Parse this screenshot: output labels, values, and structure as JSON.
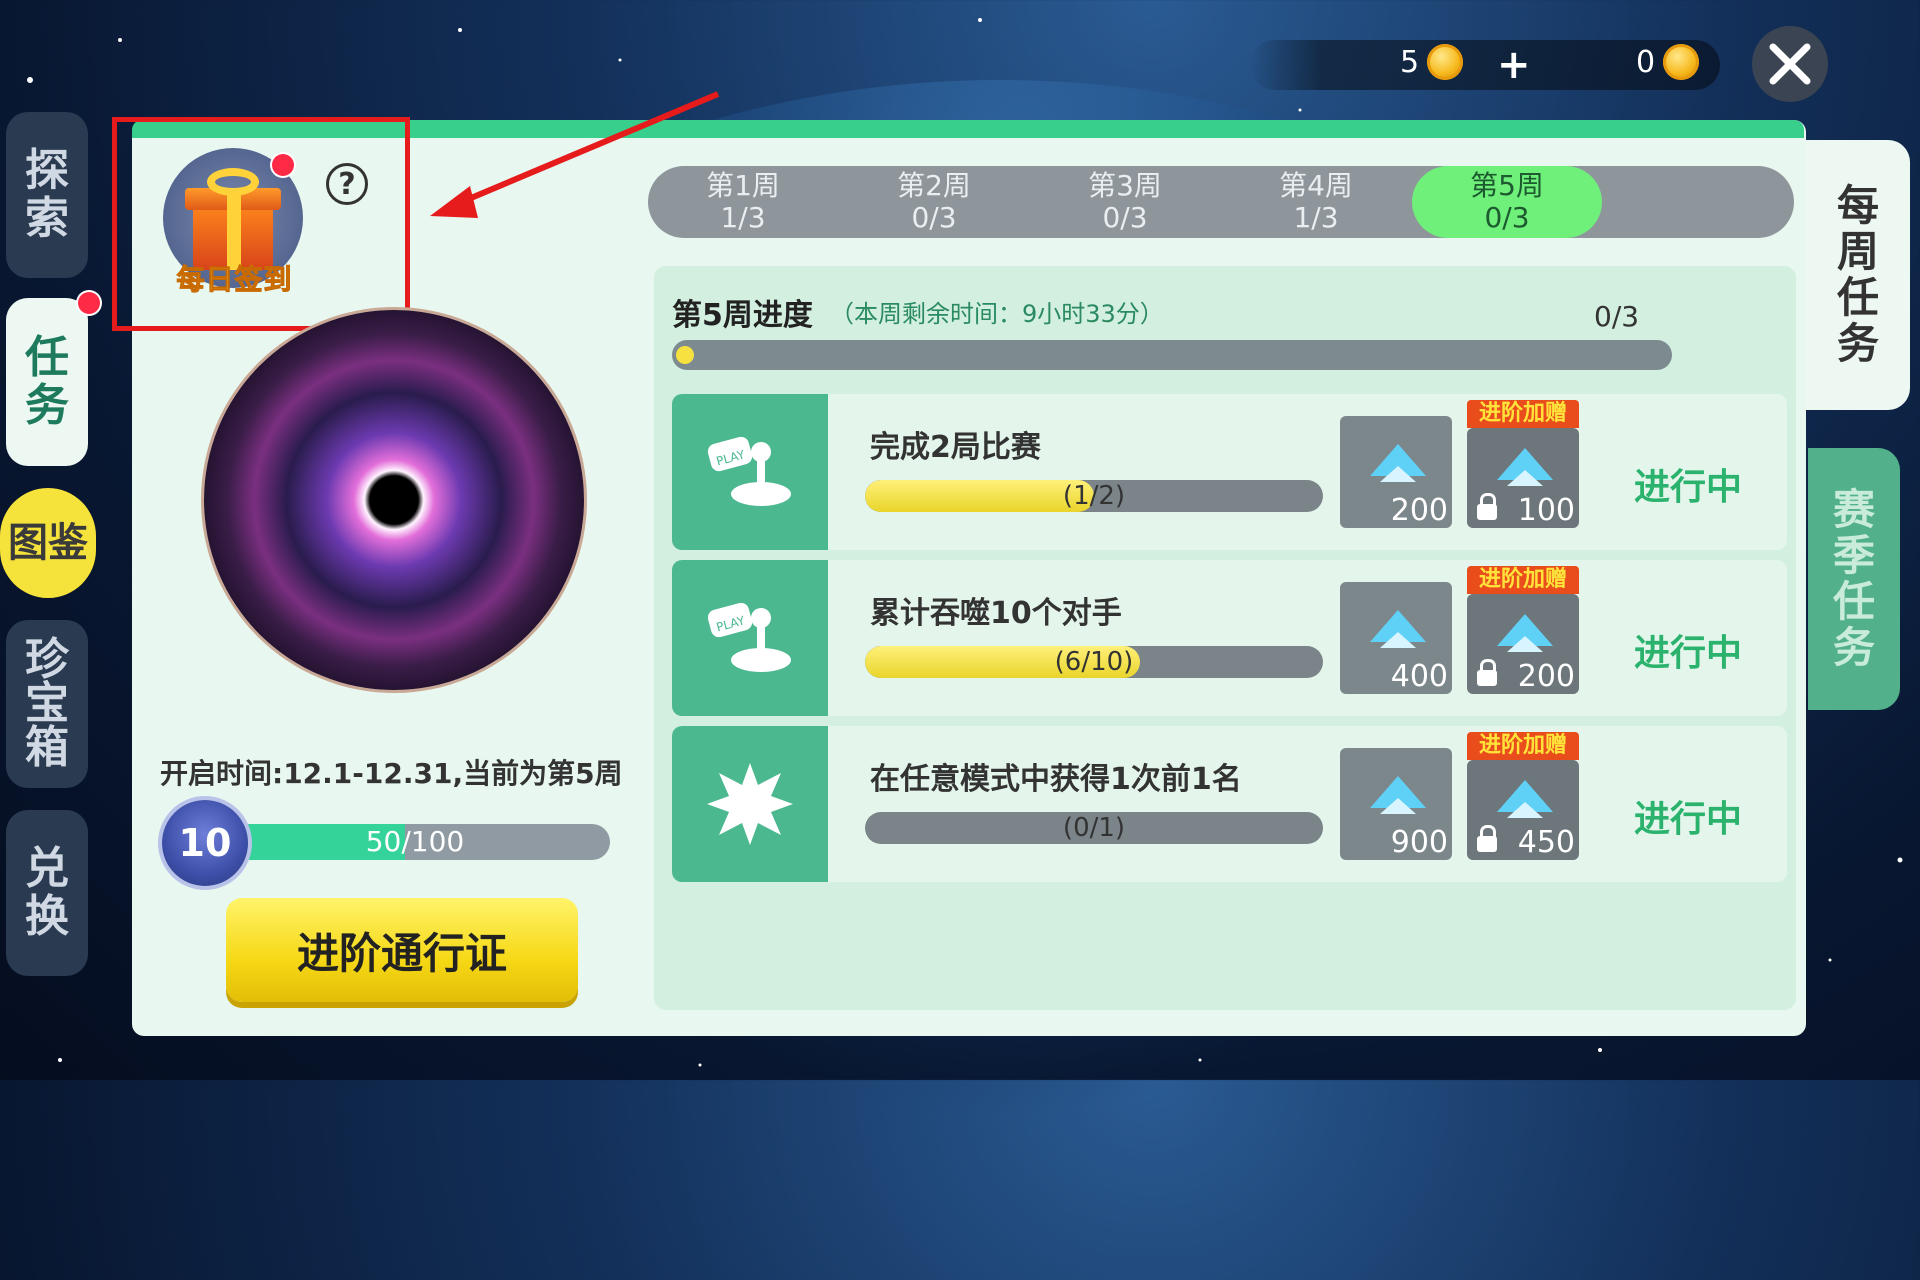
{
  "currency": {
    "coins": "5",
    "gems": "0"
  },
  "sidenav": {
    "items": [
      {
        "label": "探\n索"
      },
      {
        "label": "任\n务"
      },
      {
        "label": "图鉴"
      },
      {
        "label": "珍\n宝\n箱"
      },
      {
        "label": "兑\n换"
      }
    ]
  },
  "right_tabs": {
    "weekly": "每\n周\n任\n务",
    "season": "赛\n季\n任\n务"
  },
  "daily": {
    "label": "每日签到"
  },
  "help": "?",
  "season": {
    "open_time": "开启时间:12.1-12.31,当前为第5周",
    "level": "10",
    "xp_text": "50/100",
    "xp_fraction": 0.5,
    "pass_button": "进阶通行证"
  },
  "weeks": [
    {
      "label": "第1周",
      "progress": "1/3"
    },
    {
      "label": "第2周",
      "progress": "0/3"
    },
    {
      "label": "第3周",
      "progress": "0/3"
    },
    {
      "label": "第4周",
      "progress": "1/3"
    },
    {
      "label": "第5周",
      "progress": "0/3",
      "active": true
    }
  ],
  "week_progress": {
    "title": "第5周进度",
    "remaining": "（本周剩余时间：9小时33分）",
    "count": "0/3"
  },
  "tasks": [
    {
      "title": "完成2局比赛",
      "progress_text": "(1/2)",
      "fraction": 0.5,
      "reward": "200",
      "bonus_tag": "进阶加赠",
      "bonus": "100",
      "status": "进行中",
      "icon": "play-joystick-icon"
    },
    {
      "title": "累计吞噬10个对手",
      "progress_text": "(6/10)",
      "fraction": 0.6,
      "reward": "400",
      "bonus_tag": "进阶加赠",
      "bonus": "200",
      "status": "进行中",
      "icon": "play-joystick-icon"
    },
    {
      "title": "在任意模式中获得1次前1名",
      "progress_text": "(0/1)",
      "fraction": 0,
      "reward": "900",
      "bonus_tag": "进阶加赠",
      "bonus": "450",
      "status": "进行中",
      "icon": "spiky-ball-icon"
    }
  ],
  "colors": {
    "accent": "#37cf8b",
    "status": "#2bb36e",
    "highlight": "#e61b1b"
  }
}
